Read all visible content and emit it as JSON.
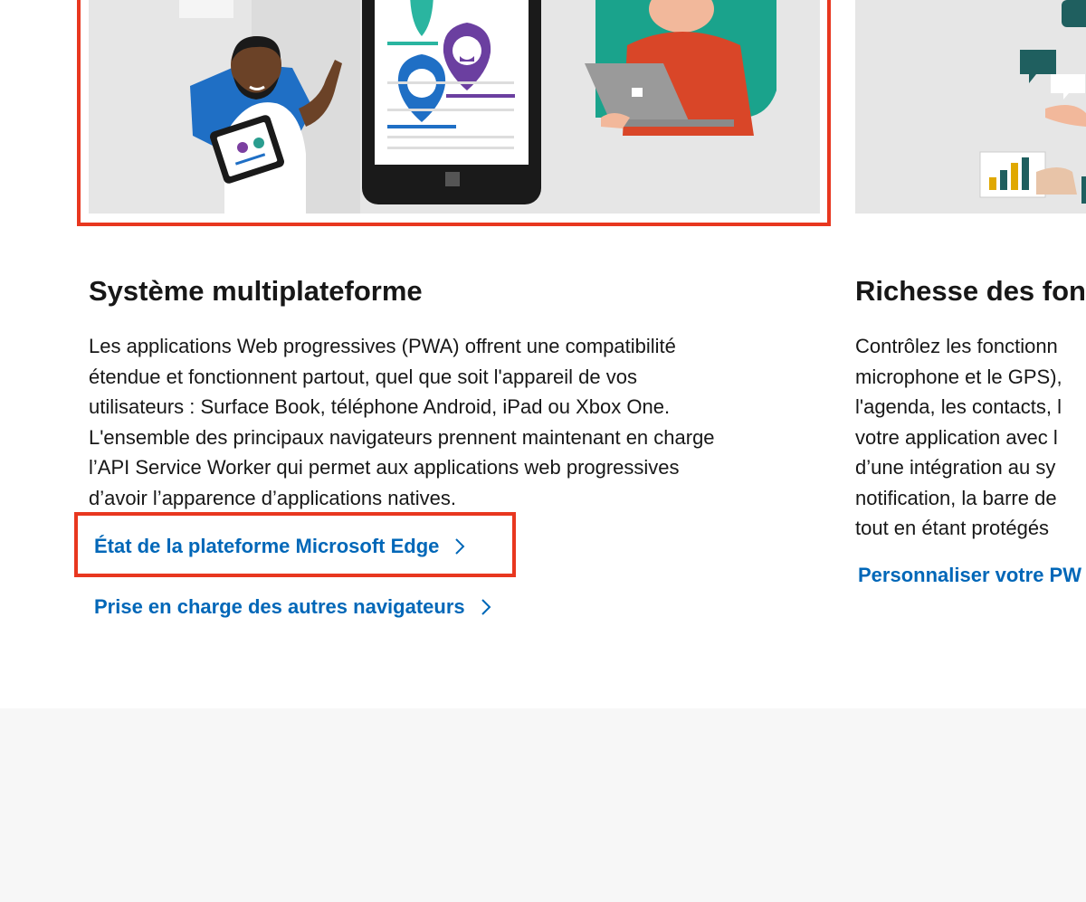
{
  "cards": [
    {
      "title": "Système multiplateforme",
      "description_lines": [
        "Les applications Web progressives (PWA) offrent une compatibilité",
        "étendue et fonctionnent partout, quel que soit l'appareil de vos",
        "utilisateurs : Surface Book, téléphone Android, iPad ou Xbox One.",
        "L'ensemble des principaux navigateurs prennent maintenant en charge",
        "l’API Service Worker qui permet aux applications web progressives",
        "d’avoir l’apparence d’applications natives."
      ],
      "links": [
        {
          "label": "État de la plateforme Microsoft Edge"
        },
        {
          "label": "Prise en charge des autres navigateurs"
        }
      ]
    },
    {
      "title": "Richesse des fonc",
      "description_lines": [
        "Contrôlez les fonctionn",
        "microphone et le GPS),",
        "l'agenda, les contacts, l",
        "votre application avec l",
        "d’une intégration au sy",
        "notification, la barre de",
        "tout en étant protégés"
      ],
      "links": [
        {
          "label": "Personnaliser votre PW"
        }
      ]
    }
  ],
  "colors": {
    "link": "#0067b8",
    "highlight": "#e8371f",
    "footer": "#f7f7f7",
    "illustration_bg": "#e6e6e6"
  },
  "icons": [
    "chevron-right-icon"
  ]
}
